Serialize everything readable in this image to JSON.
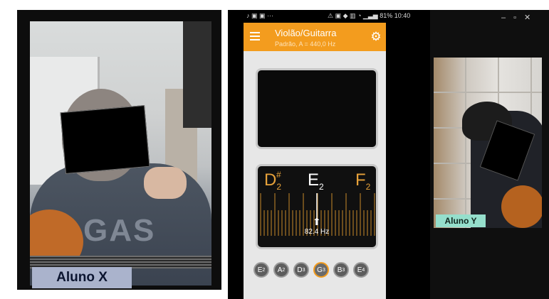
{
  "students": {
    "left_label": "Aluno X",
    "right_label": "Aluno Y"
  },
  "phone": {
    "status": {
      "right": "81% 10:40"
    },
    "app": {
      "title": "Violão/Guitarra",
      "subtitle": "Padrão, A = 440,0 Hz",
      "tuner": {
        "note_left": {
          "letter": "D",
          "sub": "2",
          "sup": "#"
        },
        "note_center": {
          "letter": "E",
          "sub": "2"
        },
        "note_right": {
          "letter": "F",
          "sub": "2"
        },
        "frequency": "82.4 Hz",
        "needle_position": 0.5
      },
      "strings": [
        {
          "letter": "E",
          "sub": "2"
        },
        {
          "letter": "A",
          "sub": "2"
        },
        {
          "letter": "D",
          "sub": "3"
        },
        {
          "letter": "G",
          "sub": "3"
        },
        {
          "letter": "B",
          "sub": "3"
        },
        {
          "letter": "E",
          "sub": "4"
        }
      ],
      "active_string": 3
    }
  },
  "colors": {
    "accent": "#f39c1e",
    "left_label_bg": "#aab3cc",
    "right_label_bg": "#95dfcc"
  },
  "icons": {
    "menu": "hamburger-menu-icon",
    "settings": "gear-icon",
    "minimize": "minimize-icon",
    "maximize": "maximize-icon",
    "close": "close-icon"
  }
}
